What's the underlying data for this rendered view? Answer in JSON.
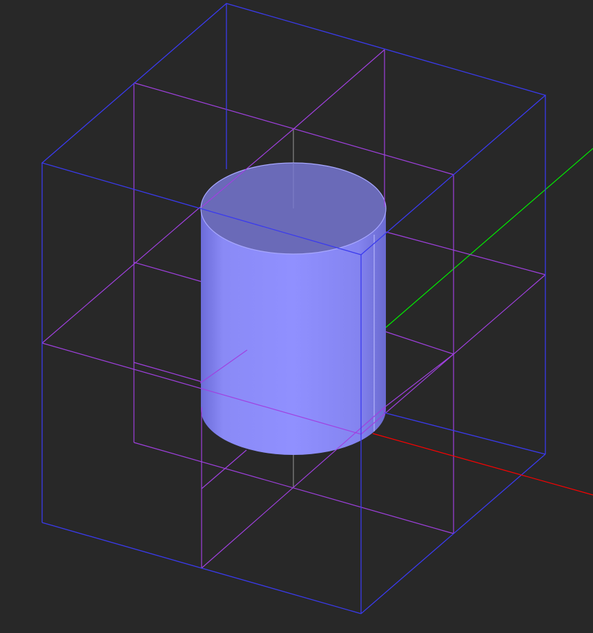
{
  "viewport": {
    "background": "#282828",
    "colors": {
      "outer_box": "#3a3aee",
      "inner_grid": "#a040e0",
      "cylinder_fill": "#8c8cff",
      "cylinder_top": "#6a6ab8",
      "axis_x": "#ff0000",
      "axis_y": "#00ee00",
      "axis_z": "#9a9a9a"
    }
  }
}
